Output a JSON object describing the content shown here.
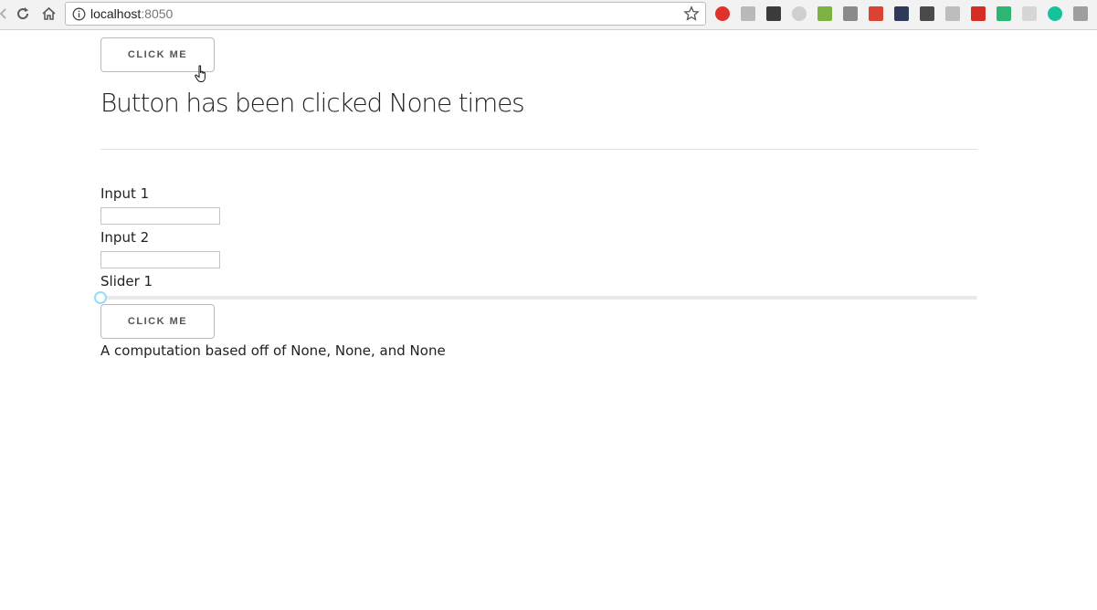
{
  "browser": {
    "url_host": "localhost",
    "url_port": ":8050",
    "extensions": [
      {
        "icon": "opera-icon",
        "color": "#e0322a"
      },
      {
        "icon": "css-icon",
        "color": "#b9b9b9"
      },
      {
        "icon": "evernote-icon",
        "color": "#3b3b3b"
      },
      {
        "icon": "circle-extension-icon",
        "color": "#cfcfcf"
      },
      {
        "icon": "leaf-icon",
        "color": "#7cb342"
      },
      {
        "icon": "camera-icon",
        "color": "#8a8a8a"
      },
      {
        "icon": "book-icon",
        "color": "#d9432f"
      },
      {
        "icon": "briefcase-icon",
        "color": "#2e3a57"
      },
      {
        "icon": "ghost-icon",
        "color": "#4a4a4a"
      },
      {
        "icon": "g-icon",
        "color": "#bdbdbd"
      },
      {
        "icon": "lastpass-icon",
        "color": "#d32d27"
      },
      {
        "icon": "r-icon",
        "color": "#2bb673"
      },
      {
        "icon": "extension-icon",
        "color": "#d6d6d6"
      },
      {
        "icon": "grammarly-icon",
        "color": "#15c39a"
      },
      {
        "icon": "search-extension-icon",
        "color": "#9e9e9e"
      }
    ]
  },
  "top_button": {
    "label": "CLICK ME"
  },
  "heading": "Button has been clicked None times",
  "input1": {
    "label": "Input 1",
    "value": ""
  },
  "input2": {
    "label": "Input 2",
    "value": ""
  },
  "slider": {
    "label": "Slider 1",
    "value": 0,
    "min": 0,
    "max": 100
  },
  "bottom_button": {
    "label": "CLICK ME"
  },
  "result": "A computation based off of None, None, and None",
  "colors": {
    "slider_handle": "#96dbfa",
    "slider_track": "#e9e9e9"
  }
}
